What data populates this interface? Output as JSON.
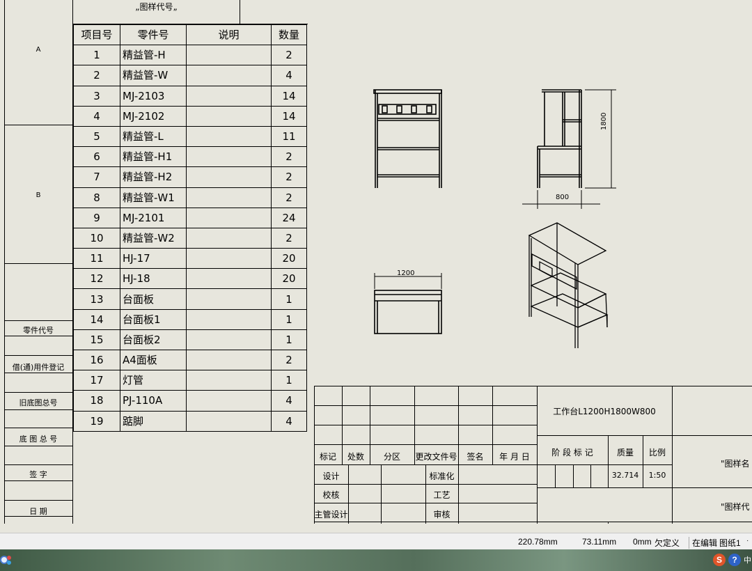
{
  "table_title": "„图样代号„",
  "zones": [
    "A",
    "B"
  ],
  "left_column_labels": [
    "零件代号",
    "借(通)用件登记",
    "旧底图总号",
    "底 图 总 号",
    "签 字",
    "日 期"
  ],
  "bom": {
    "headers": [
      "项目号",
      "零件号",
      "说明",
      "数量"
    ],
    "rows": [
      {
        "no": "1",
        "part": "精益管-H",
        "desc": "",
        "qty": "2"
      },
      {
        "no": "2",
        "part": "精益管-W",
        "desc": "",
        "qty": "4"
      },
      {
        "no": "3",
        "part": "MJ-2103",
        "desc": "",
        "qty": "14"
      },
      {
        "no": "4",
        "part": "MJ-2102",
        "desc": "",
        "qty": "14"
      },
      {
        "no": "5",
        "part": "精益管-L",
        "desc": "",
        "qty": "11"
      },
      {
        "no": "6",
        "part": "精益管-H1",
        "desc": "",
        "qty": "2"
      },
      {
        "no": "7",
        "part": "精益管-H2",
        "desc": "",
        "qty": "2"
      },
      {
        "no": "8",
        "part": "精益管-W1",
        "desc": "",
        "qty": "2"
      },
      {
        "no": "9",
        "part": "MJ-2101",
        "desc": "",
        "qty": "24"
      },
      {
        "no": "10",
        "part": "精益管-W2",
        "desc": "",
        "qty": "2"
      },
      {
        "no": "11",
        "part": "HJ-17",
        "desc": "",
        "qty": "20"
      },
      {
        "no": "12",
        "part": "HJ-18",
        "desc": "",
        "qty": "20"
      },
      {
        "no": "13",
        "part": "台面板",
        "desc": "",
        "qty": "1"
      },
      {
        "no": "14",
        "part": "台面板1",
        "desc": "",
        "qty": "1"
      },
      {
        "no": "15",
        "part": "台面板2",
        "desc": "",
        "qty": "1"
      },
      {
        "no": "16",
        "part": "A4面板",
        "desc": "",
        "qty": "2"
      },
      {
        "no": "17",
        "part": "灯管",
        "desc": "",
        "qty": "1"
      },
      {
        "no": "18",
        "part": "PJ-110A",
        "desc": "",
        "qty": "4"
      },
      {
        "no": "19",
        "part": "踮脚",
        "desc": "",
        "qty": "4"
      }
    ]
  },
  "dimensions": {
    "height": "1800",
    "depth": "800",
    "width": "1200"
  },
  "title_block": {
    "part_name": "工作台L1200H1800W800",
    "headers": [
      "标记",
      "处数",
      "分区",
      "更改文件号",
      "签名",
      "年 月 日"
    ],
    "sign_rows": [
      {
        "left": "设计",
        "right": "标准化"
      },
      {
        "left": "校核",
        "right": "工艺"
      },
      {
        "left": "主管设计",
        "right": "审核"
      }
    ],
    "stage_mark_label": "阶 段 标 记",
    "mass_label": "质量",
    "scale_label": "比例",
    "mass_value": "32.714",
    "scale_value": "1:50",
    "drawing_name_label": "\"图样名",
    "drawing_code_label": "\"图样代"
  },
  "status_bar": {
    "x": "220.78mm",
    "y": "73.11mm",
    "z": "0mm",
    "constraint": "欠定义",
    "mode": "在编辑",
    "sheet": "图纸1"
  },
  "taskbar": {
    "ime_icon": "sogou-icon",
    "help_icon": "help-icon",
    "tray_text": "中"
  }
}
